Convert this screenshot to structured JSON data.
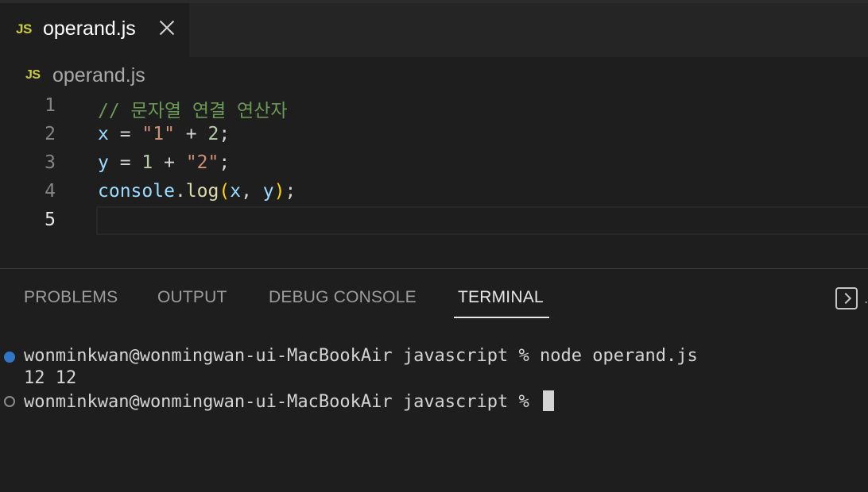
{
  "editor_tab": {
    "icon": "JS",
    "title": "operand.js"
  },
  "breadcrumb": {
    "icon": "JS",
    "file": "operand.js"
  },
  "code": {
    "active_line": 5,
    "lines": [
      {
        "number": "1",
        "tokens": [
          {
            "t": "// 문자열 연결 연산자",
            "k": "comment"
          }
        ]
      },
      {
        "number": "2",
        "tokens": [
          {
            "t": "x",
            "k": "var"
          },
          {
            "t": " = ",
            "k": "op"
          },
          {
            "t": "\"1\"",
            "k": "str"
          },
          {
            "t": " + ",
            "k": "op"
          },
          {
            "t": "2",
            "k": "num"
          },
          {
            "t": ";",
            "k": "op"
          }
        ]
      },
      {
        "number": "3",
        "tokens": [
          {
            "t": "y",
            "k": "var"
          },
          {
            "t": " = ",
            "k": "op"
          },
          {
            "t": "1",
            "k": "num"
          },
          {
            "t": " + ",
            "k": "op"
          },
          {
            "t": "\"2\"",
            "k": "str"
          },
          {
            "t": ";",
            "k": "op"
          }
        ]
      },
      {
        "number": "4",
        "tokens": [
          {
            "t": "console",
            "k": "var"
          },
          {
            "t": ".",
            "k": "op"
          },
          {
            "t": "log",
            "k": "fn"
          },
          {
            "t": "(",
            "k": "br"
          },
          {
            "t": "x",
            "k": "var"
          },
          {
            "t": ", ",
            "k": "op"
          },
          {
            "t": "y",
            "k": "var"
          },
          {
            "t": ")",
            "k": "br"
          },
          {
            "t": ";",
            "k": "op"
          }
        ]
      },
      {
        "number": "5",
        "tokens": []
      }
    ]
  },
  "panel": {
    "tabs": [
      {
        "label": "PROBLEMS"
      },
      {
        "label": "OUTPUT"
      },
      {
        "label": "DEBUG CONSOLE"
      },
      {
        "label": "TERMINAL"
      }
    ],
    "active_tab": "TERMINAL",
    "overflow_glyph": "…"
  },
  "terminal": {
    "lines": [
      {
        "text": "wonminkwan@wonmingwan-ui-MacBookAir javascript % node operand.js"
      },
      {
        "text": "12 12"
      },
      {
        "text": "wonminkwan@wonmingwan-ui-MacBookAir javascript % "
      }
    ]
  },
  "colors": {
    "background": "#1e1e1e",
    "js_badge": "#cbcb41",
    "comment": "#6a9955",
    "variable": "#9cdcfe",
    "string": "#ce9178",
    "number": "#b5cea8",
    "function": "#dcdcaa",
    "bracket": "#ffd700",
    "success_dot": "#3794ff"
  }
}
